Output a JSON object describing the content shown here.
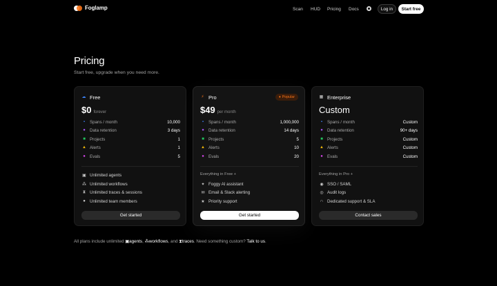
{
  "brand": {
    "name": "Foglamp"
  },
  "nav": {
    "links": [
      "Scan",
      "HUD",
      "Pricing",
      "Docs"
    ],
    "login_label": "Log in",
    "start_label": "Start free"
  },
  "page": {
    "title": "Pricing",
    "subtitle": "Start free, upgrade when you need more."
  },
  "colors": {
    "accent": "#f97316",
    "spans": "#3b82f6",
    "retention": "#a855f7",
    "projects": "#22c55e",
    "alerts": "#eab308",
    "evals": "#d946ef"
  },
  "plans": [
    {
      "name": "Free",
      "icon": "cloud-icon",
      "price": "$0",
      "price_sub": "forever",
      "metrics": [
        {
          "label": "Spans / month",
          "value": "10,000"
        },
        {
          "label": "Data retention",
          "value": "3 days"
        },
        {
          "label": "Projects",
          "value": "1"
        },
        {
          "label": "Alerts",
          "value": "1"
        },
        {
          "label": "Evals",
          "value": "5"
        }
      ],
      "features_head": "",
      "features": [
        "Unlimited agents",
        "Unlimited workflows",
        "Unlimited traces & sessions",
        "Unlimited team members"
      ],
      "cta": "Get started"
    },
    {
      "name": "Pro",
      "icon": "bolt-icon",
      "badge": "Popular",
      "price": "$49",
      "price_sub": "per month",
      "metrics": [
        {
          "label": "Spans / month",
          "value": "1,000,000"
        },
        {
          "label": "Data retention",
          "value": "14 days"
        },
        {
          "label": "Projects",
          "value": "5"
        },
        {
          "label": "Alerts",
          "value": "10"
        },
        {
          "label": "Evals",
          "value": "20"
        }
      ],
      "features_head": "Everything in Free +",
      "features": [
        "Foggy AI assistant",
        "Email & Slack alerting",
        "Priority support"
      ],
      "cta": "Get started"
    },
    {
      "name": "Enterprise",
      "icon": "building-icon",
      "price": "Custom",
      "price_sub": "",
      "metrics": [
        {
          "label": "Spans / month",
          "value": "Custom"
        },
        {
          "label": "Data retention",
          "value": "90+ days"
        },
        {
          "label": "Projects",
          "value": "Custom"
        },
        {
          "label": "Alerts",
          "value": "Custom"
        },
        {
          "label": "Evals",
          "value": "Custom"
        }
      ],
      "features_head": "Everything in Pro +",
      "features": [
        "SSO / SAML",
        "Audit logs",
        "Dedicated support & SLA"
      ],
      "cta": "Contact sales"
    }
  ],
  "footnote": {
    "part1": "All plans include unlimited",
    "agents": "agents",
    "sep1": ",",
    "workflows": "workflows",
    "and": ", and",
    "traces": "traces",
    "part2": ". Need something custom?",
    "link": "Talk to us",
    "end": "."
  }
}
